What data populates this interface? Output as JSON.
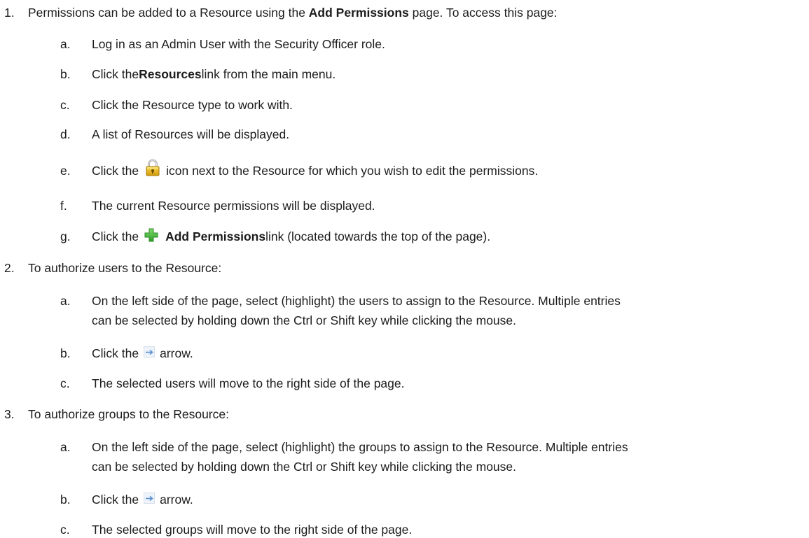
{
  "steps": [
    {
      "num": "1.",
      "parts": {
        "a": "Permissions can be added to a Resource using the ",
        "b": "Add Permissions",
        "c": " page. To access this page:"
      },
      "subs": [
        {
          "letter": "a.",
          "text": "Log in as an Admin User with the Security Officer role."
        },
        {
          "letter": "b.",
          "pre": "Click the ",
          "bold": "Resources",
          "post": " link from the main menu."
        },
        {
          "letter": "c.",
          "text": "Click the Resource type to work with."
        },
        {
          "letter": "d.",
          "text": "A list of Resources will be displayed."
        },
        {
          "letter": "e.",
          "pre": "Click the",
          "icon": "lock-icon",
          "post": "icon next to the Resource for which you wish to edit the permissions."
        },
        {
          "letter": "f.",
          "text": "The current Resource permissions will be displayed."
        },
        {
          "letter": "g.",
          "pre": "Click the",
          "icon": "green-plus-icon",
          "bold": "Add Permissions",
          "post": " link (located towards the top of the page)."
        }
      ]
    },
    {
      "num": "2.",
      "text": "To authorize users to the Resource:",
      "subs": [
        {
          "letter": "a.",
          "line1": "On the left side of the page, select (highlight) the users to assign to the Resource. Multiple entries",
          "line2": "can be selected by holding down the Ctrl or Shift key while clicking the mouse."
        },
        {
          "letter": "b.",
          "pre": "Click the",
          "icon": "right-arrow-icon",
          "post": "arrow."
        },
        {
          "letter": "c.",
          "text": "The selected users will move to the right side of the page."
        }
      ]
    },
    {
      "num": "3.",
      "text": "To authorize groups to the Resource:",
      "subs": [
        {
          "letter": "a.",
          "line1": "On the left side of the page, select (highlight) the groups to assign to the Resource. Multiple entries",
          "line2": "can be selected by holding down the Ctrl or Shift key while clicking the mouse."
        },
        {
          "letter": "b.",
          "pre": "Click the",
          "icon": "right-arrow-icon",
          "post": "arrow."
        },
        {
          "letter": "c.",
          "text": "The selected groups will move to the right side of the page."
        }
      ]
    }
  ],
  "colors": {
    "text": "#1c1c1c",
    "lock_gold": "#e3b514",
    "plus_green": "#3fb43c",
    "arrow_blue": "#5a8fd0"
  }
}
